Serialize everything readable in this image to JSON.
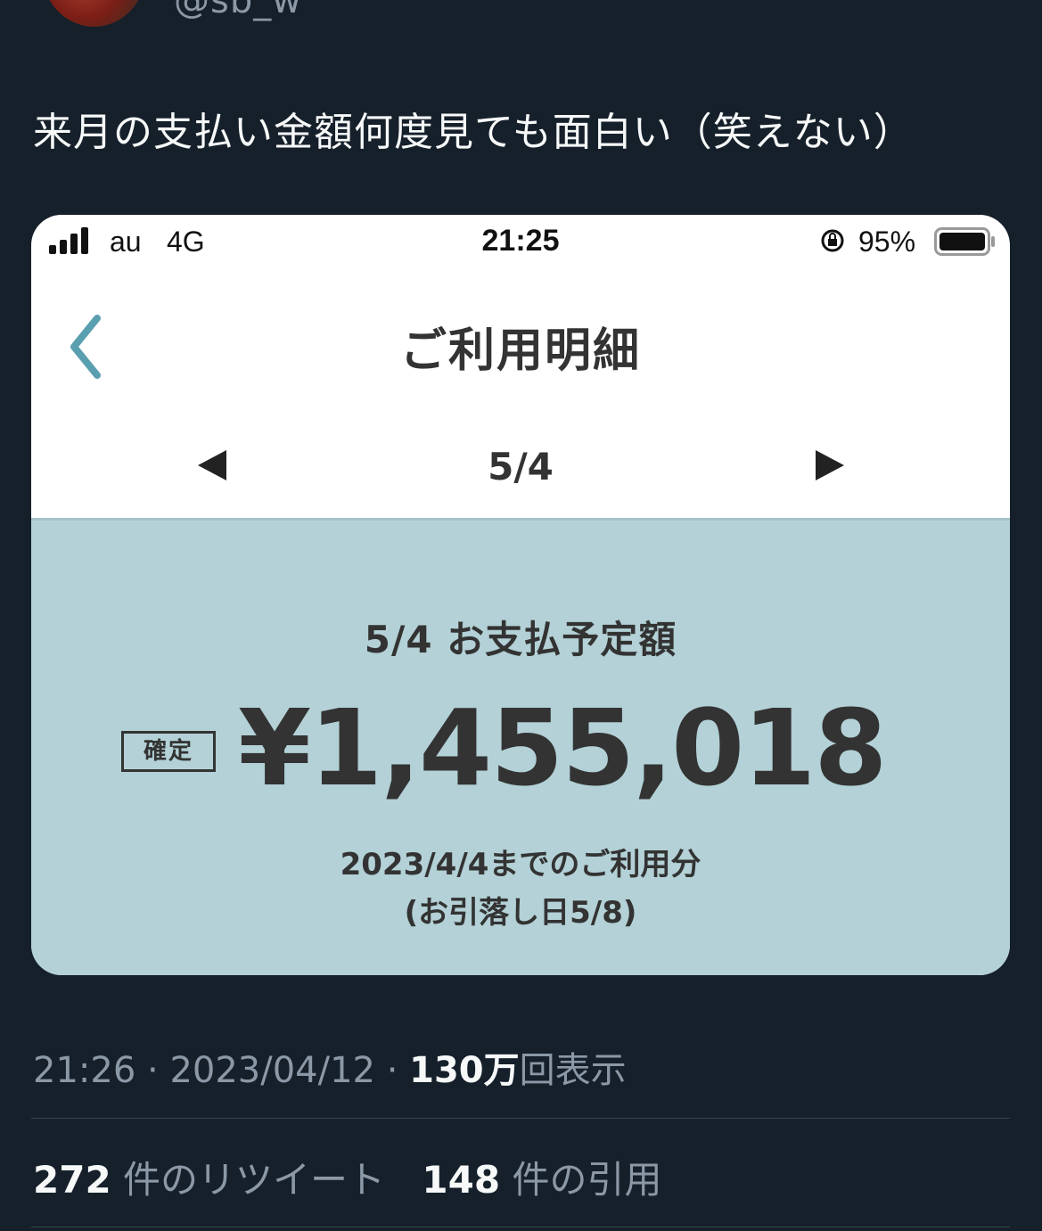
{
  "tweet": {
    "handle": "@sb_w",
    "text": "来月の支払い金額何度見ても面白い（笑えない）",
    "time": "21:26",
    "date": "2023/04/12",
    "views_count": "130万",
    "views_label": "回表示",
    "retweets_count": "272",
    "retweets_label": "件のリツイート",
    "quotes_count": "148",
    "quotes_label": "件の引用"
  },
  "screenshot": {
    "status_bar": {
      "carrier": "au",
      "network": "4G",
      "time": "21:25",
      "battery": "95%"
    },
    "nav": {
      "title": "ご利用明細",
      "period": "5/4"
    },
    "statement": {
      "due_label": "5/4 お支払予定額",
      "status_badge": "確定",
      "amount": "¥1,455,018",
      "usage_period": "2023/4/4までのご利用分",
      "debit_date": "(お引落し日5/8)"
    }
  },
  "colors": {
    "background": "#15202b",
    "panel": "#b3d1d6",
    "back_arrow": "#5a9fb0"
  },
  "icons": [
    "signal-icon",
    "orientation-lock-icon",
    "battery-icon",
    "back-chevron-icon",
    "prev-triangle-icon",
    "next-triangle-icon"
  ]
}
